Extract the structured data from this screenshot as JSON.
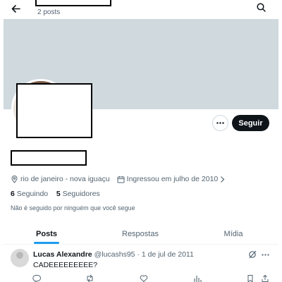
{
  "header": {
    "post_count": "2 posts",
    "back_icon": "arrow-left-icon",
    "search_icon": "search-icon"
  },
  "profile": {
    "location": "rio de janeiro - nova iguaçu",
    "joined": "Ingressou em julho de 2010",
    "following_count": "6",
    "following_label": "Seguindo",
    "followers_count": "5",
    "followers_label": "Seguidores",
    "followed_note": "Não é seguido por ninguém que você segue",
    "banner_color": "#cfd9de"
  },
  "actions": {
    "follow_label": "Seguir",
    "more_icon": "more-horizontal-icon"
  },
  "tabs": [
    {
      "label": "Posts",
      "active": true
    },
    {
      "label": "Respostas",
      "active": false
    },
    {
      "label": "Mídia",
      "active": false
    }
  ],
  "tweet": {
    "author": "Lucas Alexandre",
    "handle": "@lucashs95",
    "separator": "·",
    "date": "1 de jul de 2011",
    "text": "CADEEEEEEEEE?",
    "icons": [
      "grok-icon",
      "more-horizontal-icon",
      "reply-icon",
      "retweet-icon",
      "like-icon",
      "views-icon",
      "bookmark-icon",
      "share-icon"
    ]
  },
  "colors": {
    "accent": "#1d9bf0",
    "text_primary": "#0f1419",
    "text_secondary": "#536471",
    "follow_bg": "#0f1419"
  }
}
